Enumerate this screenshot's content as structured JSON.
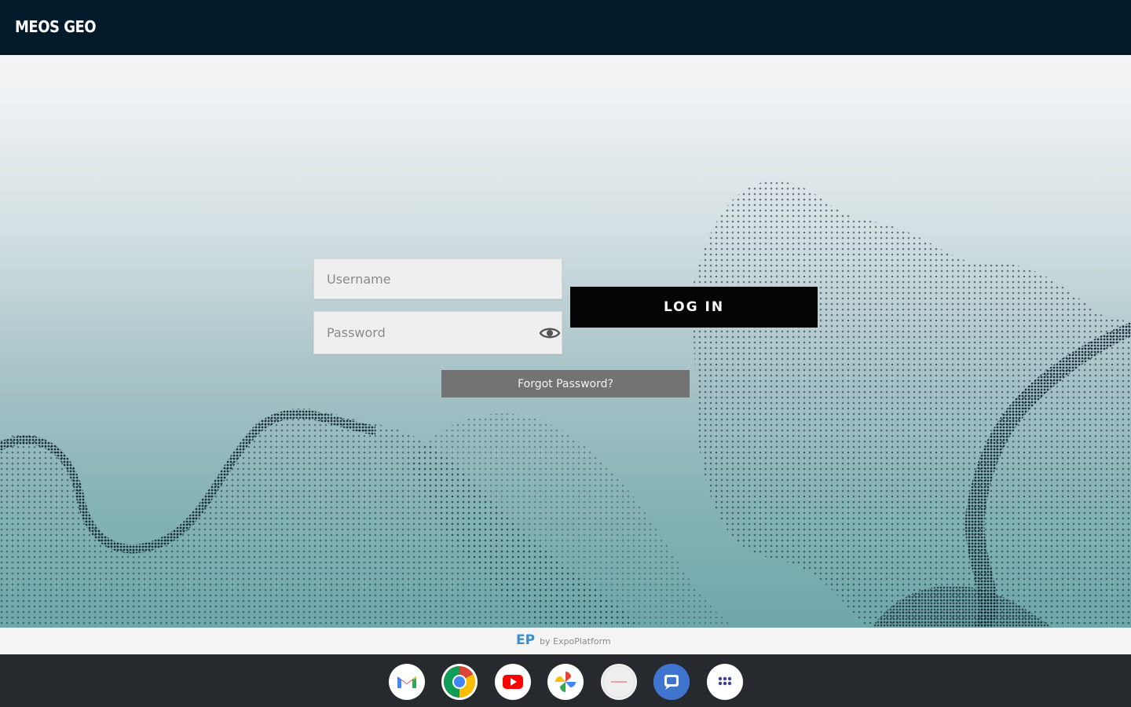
{
  "app_bar": {
    "title": "MEOS GEO"
  },
  "login_form": {
    "username_placeholder": "Username",
    "password_placeholder": "Password",
    "login_label": "LOG IN",
    "forgot_label": "Forgot Password?"
  },
  "footer": {
    "logo": "EP",
    "tagline": "by ExpoPlatform"
  },
  "shelf": {
    "apps": [
      {
        "name": "gmail-icon"
      },
      {
        "name": "chrome-icon"
      },
      {
        "name": "youtube-icon"
      },
      {
        "name": "photos-icon"
      },
      {
        "name": "app-icon"
      },
      {
        "name": "messages-icon"
      },
      {
        "name": "launcher-icon"
      }
    ]
  },
  "colors": {
    "app_bar": "#021a2a",
    "login_button": "#050505",
    "forgot_button": "#737373",
    "brand_blue": "#3a8fd1",
    "shelf": "#262a2e"
  }
}
